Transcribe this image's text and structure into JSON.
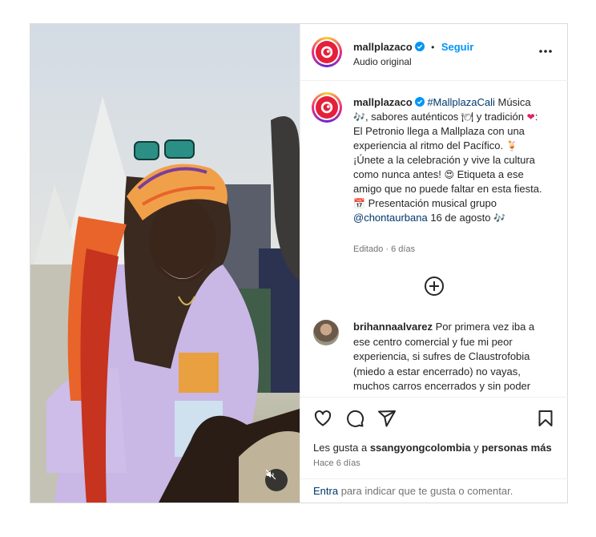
{
  "header": {
    "username": "mallplazaco",
    "separator": "•",
    "follow_label": "Seguir",
    "audio_label": "Audio original",
    "more_icon": "more-horizontal-icon"
  },
  "caption": {
    "username": "mallplazaco",
    "hashtag": "#MallplazaCali",
    "part1": " Música ",
    "part2": ", sabores auténticos ",
    "part3": " y tradición ",
    "part4": ": El Petronio llega a Mallplaza con una experiencia al ritmo del Pacífico. ",
    "part5": " ¡Únete a la celebración y vive la cultura como nunca antes! ",
    "part6": " Etiqueta a ese amigo que no puede faltar en esta fiesta. ",
    "part7": " Presentación musical grupo ",
    "mention": "@chontaurbana",
    "part8": " 16 de agosto ",
    "emoji_music": "🎶",
    "emoji_plate": "🍽",
    "emoji_heart": "❤",
    "emoji_drink": "🍹",
    "emoji_star_eyes": "😍",
    "emoji_calendar": "📅",
    "edited_label": "Editado",
    "dot": "·",
    "age": "6 días"
  },
  "comment": {
    "username": "brihannaalvarez",
    "text": " Por primera vez iba a ese centro comercial y fue mi peor experiencia, si sufres de Claustrofobia (miedo a estar encerrado) no vayas, muchos carros encerrados y sin poder"
  },
  "actions": {
    "likes_prefix": "Les gusta a ",
    "likes_user": "ssangyongcolombia",
    "likes_middle": " y ",
    "likes_others": "personas más",
    "time": "Hace 6 días"
  },
  "comment_input": {
    "enter_label": "Entra",
    "rest_label": " para indicar que te gusta o comentar."
  },
  "colors": {
    "brand_red": "#e5203a",
    "link_blue": "#0095f6",
    "tag_blue": "#00376b",
    "muted": "#737373"
  }
}
